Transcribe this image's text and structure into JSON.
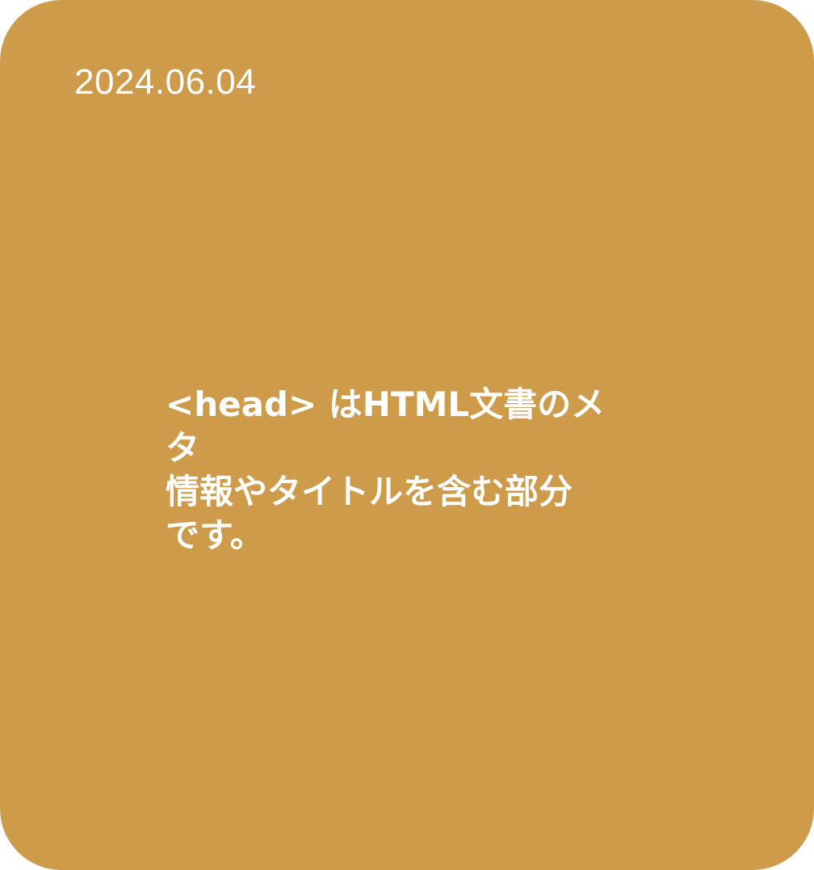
{
  "card": {
    "background_color": "#CD9B4A",
    "text_color": "#FFFFFF",
    "date": "2024.06.04",
    "message_lines": [
      "<head> はHTML文書のメ",
      "タ",
      "情報やタイトルを含む部分",
      "です。"
    ]
  }
}
